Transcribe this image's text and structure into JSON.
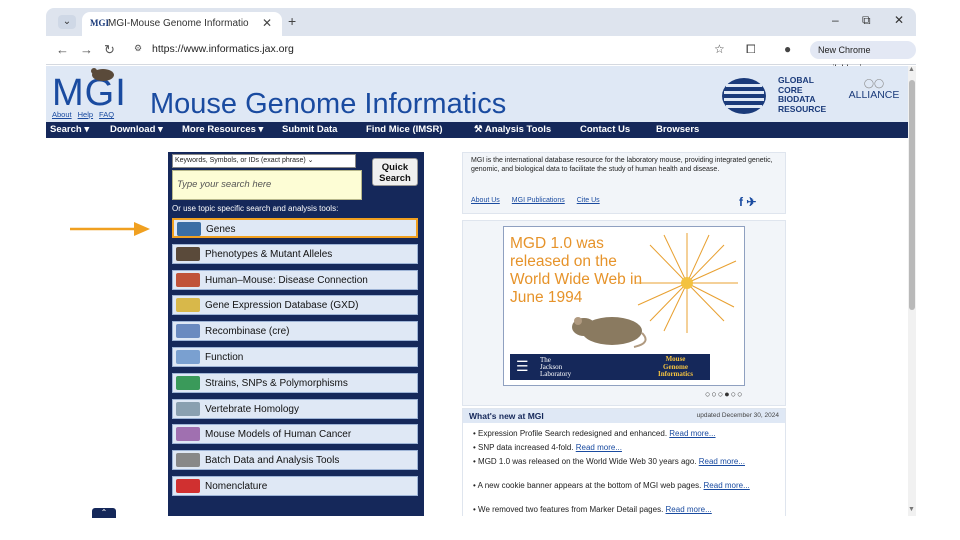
{
  "browser": {
    "tab_title": "MGI-Mouse Genome Informatio",
    "favicon_text": "MGI",
    "url": "https://www.informatics.jax.org",
    "update_label": "New Chrome available"
  },
  "header": {
    "logo": "MGI",
    "logo_links": [
      "About",
      "Help",
      "FAQ"
    ],
    "title": "Mouse Genome Informatics",
    "gbc_lines": [
      "GLOBAL",
      "CORE",
      "BIODATA",
      "RESOURCE"
    ],
    "alliance": "ALLIANCE"
  },
  "menu": {
    "items": [
      "Search ▾",
      "Download ▾",
      "More Resources ▾",
      "Submit Data",
      "Find Mice (IMSR)",
      "Analysis Tools",
      "Contact Us",
      "Browsers"
    ]
  },
  "search": {
    "select_value": "Keywords, Symbols, or IDs (exact phrase)",
    "placeholder": "Type your search here",
    "quick_search_label": "Quick Search",
    "topic_label": "Or use topic specific search and analysis tools:",
    "topics": [
      {
        "label": "Genes",
        "color": "#3a6ea5"
      },
      {
        "label": "Phenotypes & Mutant Alleles",
        "color": "#5a4a3a"
      },
      {
        "label": "Human–Mouse: Disease Connection",
        "color": "#c0533a"
      },
      {
        "label": "Gene Expression Database (GXD)",
        "color": "#d8b84a"
      },
      {
        "label": "Recombinase (cre)",
        "color": "#6a8ac0"
      },
      {
        "label": "Function",
        "color": "#7aa0d0"
      },
      {
        "label": "Strains, SNPs & Polymorphisms",
        "color": "#3a9a5a"
      },
      {
        "label": "Vertebrate Homology",
        "color": "#8aa0b0"
      },
      {
        "label": "Mouse Models of Human Cancer",
        "color": "#a070b0"
      },
      {
        "label": "Batch Data and Analysis Tools",
        "color": "#888888"
      },
      {
        "label": "Nomenclature",
        "color": "#d03030"
      }
    ]
  },
  "intro": {
    "text": "MGI is the international database resource for the laboratory mouse, providing integrated genetic, genomic, and biological data to facilitate the study of human health and disease.",
    "links": [
      "About Us",
      "MGI Publications",
      "Cite Us"
    ]
  },
  "banner": {
    "headline": "MGD 1.0 was released on the World Wide Web in June 1994",
    "jax_lines": [
      "The",
      "Jackson",
      "Laboratory"
    ],
    "mgi_lines": [
      "Mouse",
      "Genome",
      "Informatics"
    ],
    "dots": "○○○●○○"
  },
  "news": {
    "title": "What's new at MGI",
    "updated": "updated December 30, 2024",
    "items": [
      {
        "text": "Expression Profile Search redesigned and enhanced.",
        "more": "Read more..."
      },
      {
        "text": "SNP data increased 4-fold.",
        "more": "Read more..."
      },
      {
        "text": "MGD 1.0 was released on the World Wide Web 30 years ago.",
        "more": "Read more..."
      },
      {
        "text": "A new cookie banner appears at the bottom of MGI web pages.",
        "more": "Read more..."
      },
      {
        "text": "We removed two features from Marker Detail pages.",
        "more": "Read more..."
      }
    ]
  },
  "colors": {
    "navy": "#15285a",
    "accent_orange": "#f0a020",
    "link_blue": "#1a4ba0"
  }
}
